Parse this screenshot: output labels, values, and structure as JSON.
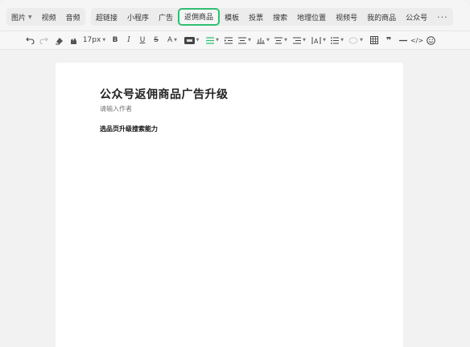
{
  "insert_menu": {
    "group1": [
      {
        "label": "图片",
        "dropdown": true
      },
      {
        "label": "视频",
        "dropdown": false
      },
      {
        "label": "音频",
        "dropdown": false
      }
    ],
    "group2": [
      {
        "label": "超链接",
        "active": false
      },
      {
        "label": "小程序",
        "active": false
      },
      {
        "label": "广告",
        "active": false
      },
      {
        "label": "返佣商品",
        "active": true
      },
      {
        "label": "模板",
        "active": false
      },
      {
        "label": "投票",
        "active": false
      },
      {
        "label": "搜索",
        "active": false
      },
      {
        "label": "地理位置",
        "active": false
      },
      {
        "label": "视频号",
        "active": false
      },
      {
        "label": "我的商品",
        "active": false
      },
      {
        "label": "公众号",
        "active": false
      }
    ],
    "more": "···"
  },
  "format_toolbar": {
    "font_size": "17px",
    "bold": "B",
    "italic": "I",
    "underline": "U",
    "strikethrough": "S",
    "font_color": "A",
    "quote": "❞",
    "code": "</>"
  },
  "editor": {
    "title": "公众号返佣商品广告升级",
    "author_placeholder": "请输入作者",
    "body_text": "选品页升级搜索能力"
  },
  "colors": {
    "active_outline": "#2fbf71",
    "page_background": "#f2f2f2",
    "editor_background": "#ffffff"
  },
  "icons": [
    "undo-icon",
    "redo-icon",
    "clear-format-icon",
    "format-painter-icon",
    "background-color-icon",
    "align-icon",
    "indent-icon",
    "line-height-icon",
    "paragraph-spacing-icon",
    "letter-spacing-icon",
    "list-icon",
    "table-icon",
    "quote-icon",
    "divider-icon",
    "code-icon",
    "emoji-icon"
  ]
}
